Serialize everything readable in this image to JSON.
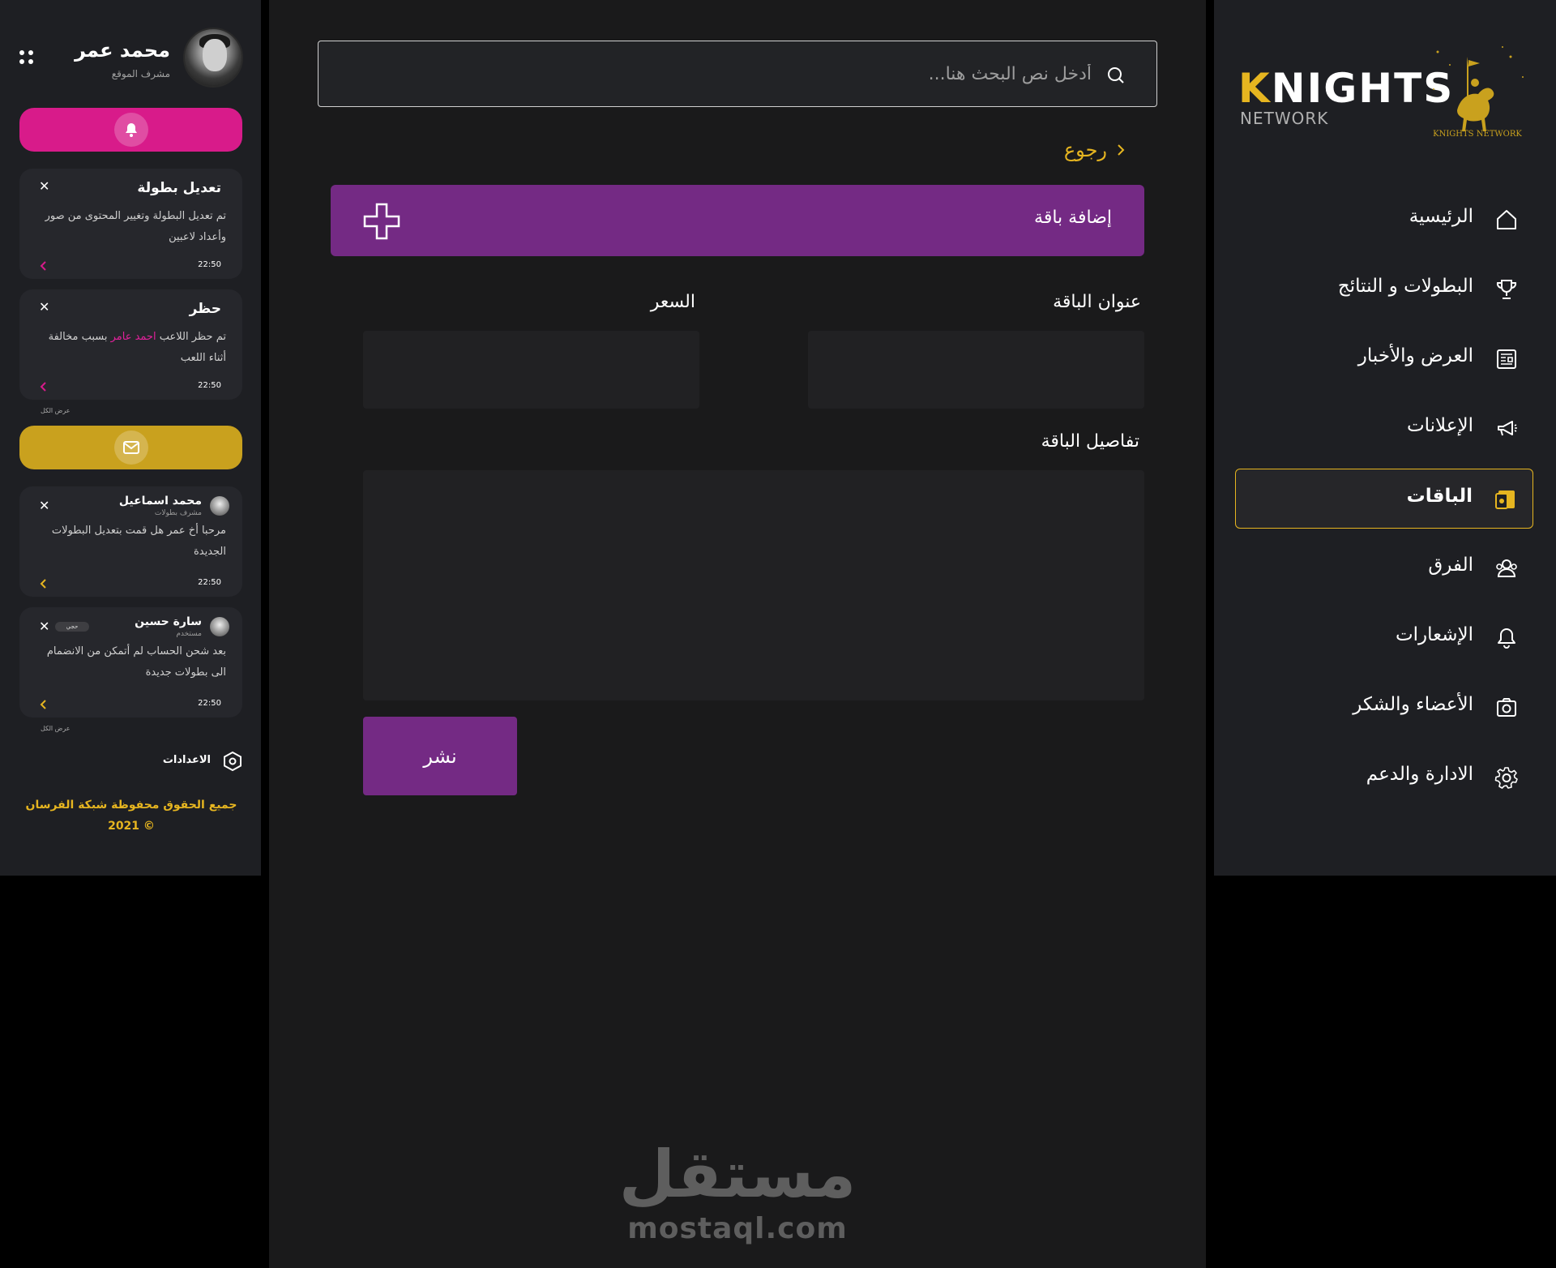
{
  "user": {
    "name": "محمد عمر",
    "role": "مشرف الموقع"
  },
  "notifications": [
    {
      "title": "تعديل بطولة",
      "body": "تم تعديل البطولة وتغيير المحتوى من صور وأعداد لاعبين",
      "time": "22:50"
    },
    {
      "title": "حظر",
      "body_before": "تم حظر اللاعب ",
      "highlight": "احمد عامر",
      "body_after": " بسبب مخالفة أثناء اللعب",
      "time": "22:50"
    }
  ],
  "notifications_view_all": "عرض الكل",
  "messages": [
    {
      "sender": "محمد اسماعيل",
      "role": "مشرف بطولات",
      "body": "مرحبا أخ عمر هل قمت بتعديل البطولات الجديدة",
      "time": "22:50"
    },
    {
      "sender": "سارة حسين",
      "role": "مستخدم",
      "tag": "حجي",
      "body": "بعد شحن الحساب لم أتمكن من الانضمام الى بطولات جديدة",
      "time": "22:50"
    }
  ],
  "messages_view_all": "عرض الكل",
  "settings_label": "الاعدادات",
  "copyright": {
    "line1": "جميع الحقوق محفوظة شبكة الفرسان",
    "line2": "© 2021"
  },
  "search": {
    "placeholder": "أدخل نص البحث هنا..."
  },
  "back_label": "رجوع",
  "banner_title": "إضافة باقة",
  "form": {
    "title_label": "عنوان الباقة",
    "price_label": "السعر",
    "details_label": "تفاصيل الباقة",
    "submit_label": "نشر"
  },
  "logo": {
    "brand_k": "K",
    "brand_rest": "NIGHTS",
    "sub": "NETWORK",
    "emblem_text": "KNIGHTS NETWORK"
  },
  "nav": [
    {
      "label": "الرئيسية",
      "icon": "home-icon"
    },
    {
      "label": "البطولات و النتائج",
      "icon": "trophy-icon"
    },
    {
      "label": "العرض والأخبار",
      "icon": "newspaper-icon"
    },
    {
      "label": "الإعلانات",
      "icon": "megaphone-icon"
    },
    {
      "label": "الباقات",
      "icon": "package-icon",
      "active": true
    },
    {
      "label": "الفرق",
      "icon": "team-icon"
    },
    {
      "label": "الإشعارات",
      "icon": "bell-icon"
    },
    {
      "label": "الأعضاء والشكر",
      "icon": "members-icon"
    },
    {
      "label": "الادارة والدعم",
      "icon": "gear-icon"
    }
  ],
  "watermark": {
    "ar": "مستقل",
    "en": "mostaql.com"
  },
  "colors": {
    "accent_gold": "#e6b520",
    "purple": "#742a84",
    "pink": "#d81b8a",
    "panel": "#1e1f23"
  }
}
